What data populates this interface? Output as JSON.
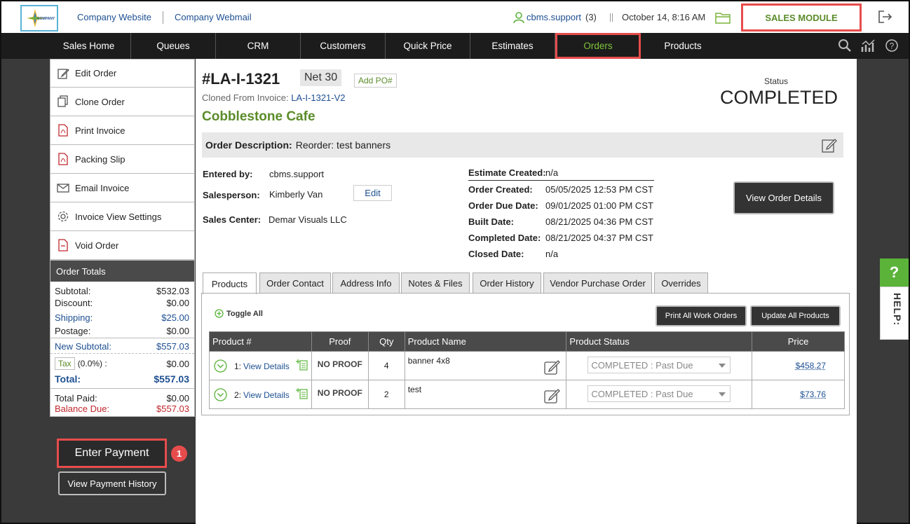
{
  "header": {
    "logo_text": "COMPANY",
    "links": [
      "Company Website",
      "Company Webmail"
    ],
    "user": "cbms.support",
    "user_count": "(3)",
    "datetime": "October 14, 8:16 AM",
    "module": "SALES MODULE"
  },
  "nav": {
    "items": [
      "Sales Home",
      "Queues",
      "CRM",
      "Customers",
      "Quick Price",
      "Estimates",
      "Orders",
      "Products"
    ],
    "active": "Orders"
  },
  "sidebar": {
    "actions": [
      "Edit Order",
      "Clone Order",
      "Print Invoice",
      "Packing Slip",
      "Email Invoice",
      "Invoice View Settings",
      "Void Order"
    ],
    "totals_title": "Order Totals",
    "totals": {
      "subtotal_label": "Subtotal:",
      "subtotal": "$532.03",
      "discount_label": "Discount:",
      "discount": "$0.00",
      "shipping_label": "Shipping:",
      "shipping": "$25.00",
      "postage_label": "Postage:",
      "postage": "$0.00",
      "new_subtotal_label": "New Subtotal:",
      "new_subtotal": "$557.03",
      "tax_label": "Tax",
      "tax_rate": "(0.0%) :",
      "tax": "$0.00",
      "total_label": "Total:",
      "total": "$557.03",
      "paid_label": "Total Paid:",
      "paid": "$0.00",
      "balance_label": "Balance Due:",
      "balance": "$557.03"
    },
    "enter_payment": "Enter Payment",
    "step_number": "1",
    "payment_history": "View Payment History"
  },
  "order": {
    "id": "#LA-I-1321",
    "terms": "Net 30",
    "add_po": "Add PO#",
    "cloned_label": "Cloned From Invoice:",
    "cloned_link": "LA-I-1321-V2",
    "customer": "Cobblestone Cafe",
    "status_label": "Status",
    "status": "COMPLETED",
    "description_label": "Order Description:",
    "description": "Reorder: test banners",
    "entered_by_label": "Entered by:",
    "entered_by": "cbms.support",
    "salesperson_label": "Salesperson:",
    "salesperson": "Kimberly Van",
    "edit_label": "Edit",
    "sales_center_label": "Sales Center:",
    "sales_center": "Demar Visuals LLC",
    "dates": [
      {
        "label": "Estimate Created:",
        "value": "n/a"
      },
      {
        "label": "Order Created:",
        "value": "05/05/2025 12:53 PM CST"
      },
      {
        "label": "Order Due Date:",
        "value": "09/01/2025 01:00 PM CST"
      },
      {
        "label": "Built Date:",
        "value": "08/21/2025 04:36 PM CST"
      },
      {
        "label": "Completed Date:",
        "value": "08/21/2025 04:37 PM CST"
      },
      {
        "label": "Closed Date:",
        "value": "n/a"
      }
    ],
    "view_details_btn": "View Order Details"
  },
  "tabs": [
    "Products",
    "Order Contact",
    "Address Info",
    "Notes & Files",
    "Order History",
    "Vendor Purchase Order",
    "Overrides"
  ],
  "products": {
    "toggle_all": "Toggle All",
    "print_all": "Print All Work Orders",
    "update_all": "Update All Products",
    "columns": [
      "Product #",
      "Proof",
      "Qty",
      "Product Name",
      "Product Status",
      "Price"
    ],
    "rows": [
      {
        "num": "1:",
        "link": "View Details",
        "proof": "NO PROOF",
        "qty": "4",
        "name": "banner 4x8",
        "status": "COMPLETED : Past Due",
        "price": "$458.27"
      },
      {
        "num": "2:",
        "link": "View Details",
        "proof": "NO PROOF",
        "qty": "2",
        "name": "test",
        "status": "COMPLETED : Past Due",
        "price": "$73.76"
      }
    ]
  },
  "help": {
    "icon": "?",
    "label": "HELP:"
  }
}
